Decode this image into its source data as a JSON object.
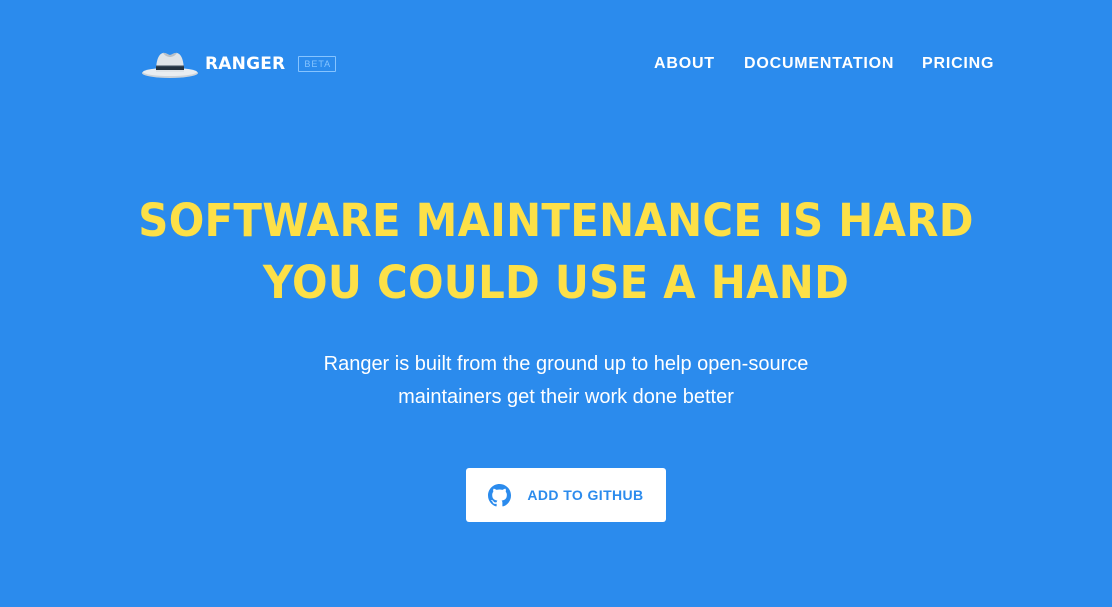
{
  "header": {
    "brand_name": "RANGER",
    "badge": "BETA",
    "logo_icon": "ranger-hat-icon"
  },
  "nav": {
    "items": [
      {
        "label": "ABOUT"
      },
      {
        "label": "DOCUMENTATION"
      },
      {
        "label": "PRICING"
      }
    ]
  },
  "hero": {
    "headline_lines": [
      "SOFTWARE MAINTENANCE IS HARD",
      "YOU COULD USE A HAND"
    ],
    "subtitle_lines": [
      "Ranger is built from the ground up to help open-source",
      "maintainers get their work done better"
    ],
    "cta": {
      "label": "ADD TO GITHUB",
      "icon": "github-icon"
    }
  },
  "colors": {
    "background": "#2b8bed",
    "headline": "#fde047",
    "text": "#ffffff",
    "button_bg": "#ffffff",
    "button_text": "#2b8bed",
    "badge": "#86c4ff"
  }
}
